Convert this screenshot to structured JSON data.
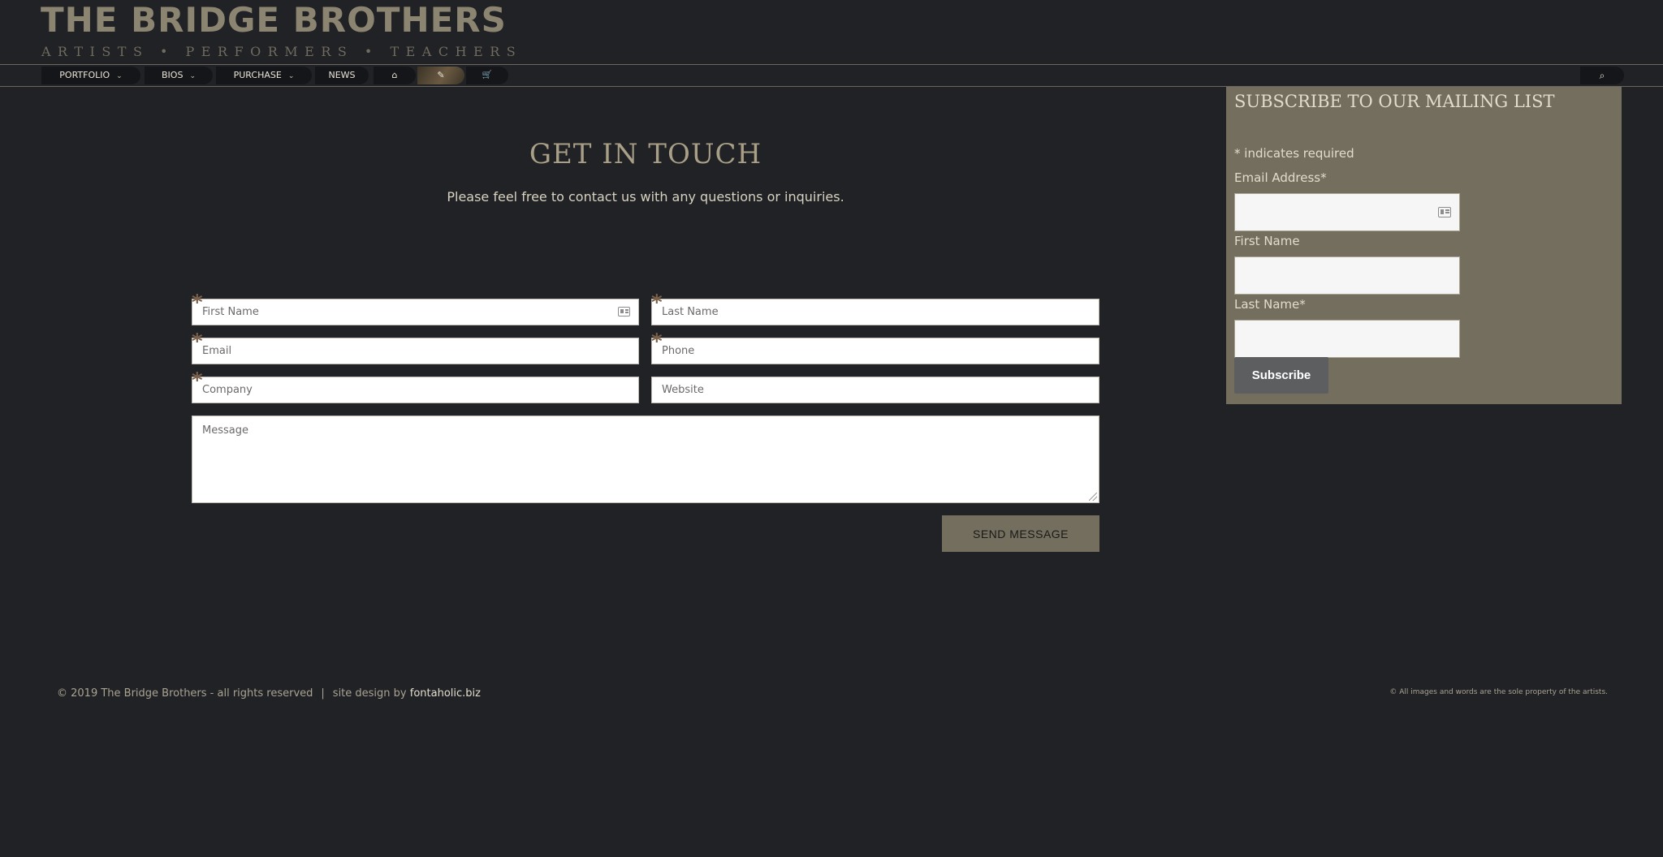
{
  "header": {
    "site_title": "THE BRIDGE BROTHERS",
    "tagline": "ARTISTS • PERFORMERS • TEACHERS"
  },
  "nav": {
    "items": [
      {
        "label": "PORTFOLIO",
        "has_dropdown": true
      },
      {
        "label": "BIOS",
        "has_dropdown": true
      },
      {
        "label": "PURCHASE",
        "has_dropdown": true
      },
      {
        "label": "NEWS",
        "has_dropdown": false
      },
      {
        "icon": "home-icon",
        "glyph": "⌂"
      },
      {
        "icon": "pencil-icon",
        "glyph": "✎"
      },
      {
        "icon": "cart-icon",
        "glyph": "🛒"
      }
    ],
    "search_icon": "⌕"
  },
  "contact": {
    "heading": "GET IN TOUCH",
    "intro": "Please feel free to contact us with any questions or inquiries.",
    "fields": {
      "first_name": "First Name",
      "last_name": "Last Name",
      "email": "Email",
      "phone": "Phone",
      "company": "Company",
      "website": "Website",
      "message": "Message"
    },
    "send_label": "SEND MESSAGE"
  },
  "mailing": {
    "title": "SUBSCRIBE TO OUR MAILING LIST",
    "required_note": "indicates required",
    "email_label": "Email Address",
    "first_name_label": "First Name",
    "last_name_label": "Last Name",
    "subscribe_label": "Subscribe"
  },
  "footer": {
    "copyright": "© 2019 The Bridge Brothers - all rights reserved",
    "separator": "|",
    "credit_prefix": "site design by",
    "credit_link": "fontaholic.biz",
    "rights_note": "© All images and words are the sole property of the artists."
  },
  "colors": {
    "background": "#212226",
    "accent": "#736e5e",
    "title": "#8b8470"
  }
}
